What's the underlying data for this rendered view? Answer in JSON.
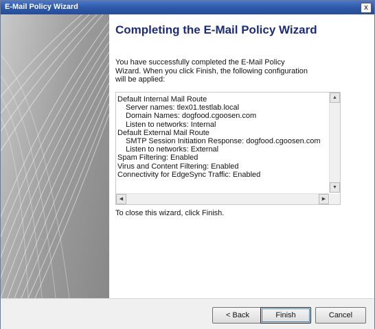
{
  "window": {
    "title": "E-Mail Policy Wizard",
    "close_glyph": "x"
  },
  "main": {
    "heading": "Completing the E-Mail Policy Wizard",
    "intro": "You have successfully completed the E-Mail Policy Wizard. When you click Finish, the following configuration will be applied:",
    "summary": {
      "lines": [
        {
          "text": "Default Internal Mail Route",
          "indent": false
        },
        {
          "text": "Server names: tlex01.testlab.local",
          "indent": true
        },
        {
          "text": "Domain Names: dogfood.cgoosen.com",
          "indent": true
        },
        {
          "text": "Listen to networks: Internal",
          "indent": true
        },
        {
          "text": "Default External Mail Route",
          "indent": false
        },
        {
          "text": "SMTP Session Initiation Response: dogfood.cgoosen.com",
          "indent": true
        },
        {
          "text": "Listen to networks: External",
          "indent": true
        },
        {
          "text": "Spam Filtering: Enabled",
          "indent": false
        },
        {
          "text": "Virus and Content Filtering: Enabled",
          "indent": false
        },
        {
          "text": "Connectivity for EdgeSync Traffic: Enabled",
          "indent": false
        }
      ]
    },
    "closing": "To close this wizard, click Finish."
  },
  "buttons": {
    "back": "< Back",
    "finish": "Finish",
    "cancel": "Cancel"
  },
  "colors": {
    "titlebar": "#2f5aa8",
    "heading": "#1c2b7a"
  }
}
